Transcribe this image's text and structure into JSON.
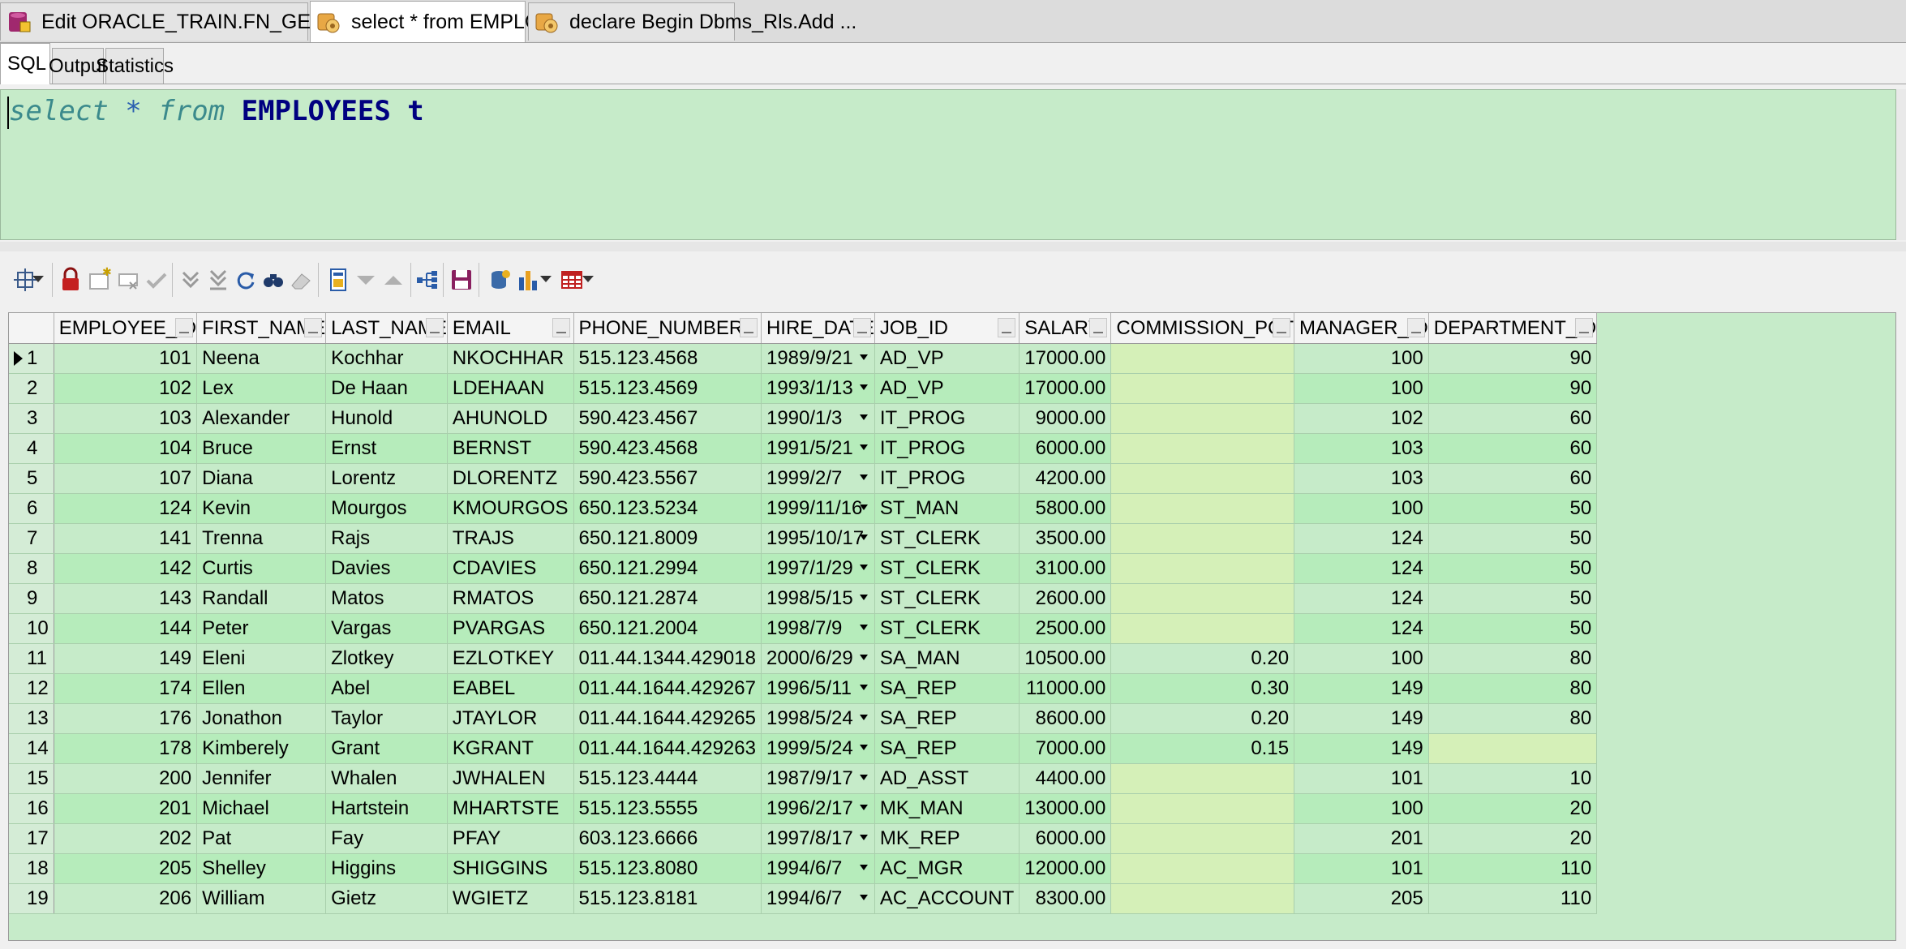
{
  "doc_tabs": [
    {
      "label": "Edit ORACLE_TRAIN.FN_GETEMPLOYEES@ORCL"
    },
    {
      "label": "select * from EMPLOYEES t"
    },
    {
      "label": "declare Begin Dbms_Rls.Add ..."
    }
  ],
  "close_glyph": "✕",
  "sub_tabs": [
    {
      "label": "SQL"
    },
    {
      "label": "Output"
    },
    {
      "label": "Statistics"
    }
  ],
  "editor": {
    "kw_select": "select",
    "op_star": " * ",
    "kw_from": "from",
    "ident": " EMPLOYEES t"
  },
  "toolbar": {
    "icons": [
      "grid-options-icon",
      "lock-icon",
      "insert-record-icon",
      "delete-record-icon",
      "post-changes-icon",
      "next-page-icon",
      "last-page-icon",
      "refresh-icon",
      "find-icon",
      "clear-icon",
      "export-icon",
      "move-down-icon",
      "move-up-icon",
      "query-plan-icon",
      "save-icon",
      "connect-icon",
      "chart-icon",
      "single-record-icon"
    ]
  },
  "grid": {
    "columns": [
      "EMPLOYEE_ID",
      "FIRST_NAME",
      "LAST_NAME",
      "EMAIL",
      "PHONE_NUMBER",
      "HIRE_DATE",
      "JOB_ID",
      "SALARY",
      "COMMISSION_PCT",
      "MANAGER_ID",
      "DEPARTMENT_ID"
    ],
    "dots_glyph": "···",
    "rows": [
      {
        "rn": "1",
        "id": "101",
        "first": "Neena",
        "last": "Kochhar",
        "email": "NKOCHHAR",
        "phone": "515.123.4568",
        "hire": "1989/9/21",
        "job": "AD_VP",
        "salary": "17000.00",
        "comm": "",
        "mgr": "100",
        "dept": "90"
      },
      {
        "rn": "2",
        "id": "102",
        "first": "Lex",
        "last": "De Haan",
        "email": "LDEHAAN",
        "phone": "515.123.4569",
        "hire": "1993/1/13",
        "job": "AD_VP",
        "salary": "17000.00",
        "comm": "",
        "mgr": "100",
        "dept": "90"
      },
      {
        "rn": "3",
        "id": "103",
        "first": "Alexander",
        "last": "Hunold",
        "email": "AHUNOLD",
        "phone": "590.423.4567",
        "hire": "1990/1/3",
        "job": "IT_PROG",
        "salary": "9000.00",
        "comm": "",
        "mgr": "102",
        "dept": "60"
      },
      {
        "rn": "4",
        "id": "104",
        "first": "Bruce",
        "last": "Ernst",
        "email": "BERNST",
        "phone": "590.423.4568",
        "hire": "1991/5/21",
        "job": "IT_PROG",
        "salary": "6000.00",
        "comm": "",
        "mgr": "103",
        "dept": "60"
      },
      {
        "rn": "5",
        "id": "107",
        "first": "Diana",
        "last": "Lorentz",
        "email": "DLORENTZ",
        "phone": "590.423.5567",
        "hire": "1999/2/7",
        "job": "IT_PROG",
        "salary": "4200.00",
        "comm": "",
        "mgr": "103",
        "dept": "60"
      },
      {
        "rn": "6",
        "id": "124",
        "first": "Kevin",
        "last": "Mourgos",
        "email": "KMOURGOS",
        "phone": "650.123.5234",
        "hire": "1999/11/16",
        "job": "ST_MAN",
        "salary": "5800.00",
        "comm": "",
        "mgr": "100",
        "dept": "50"
      },
      {
        "rn": "7",
        "id": "141",
        "first": "Trenna",
        "last": "Rajs",
        "email": "TRAJS",
        "phone": "650.121.8009",
        "hire": "1995/10/17",
        "job": "ST_CLERK",
        "salary": "3500.00",
        "comm": "",
        "mgr": "124",
        "dept": "50"
      },
      {
        "rn": "8",
        "id": "142",
        "first": "Curtis",
        "last": "Davies",
        "email": "CDAVIES",
        "phone": "650.121.2994",
        "hire": "1997/1/29",
        "job": "ST_CLERK",
        "salary": "3100.00",
        "comm": "",
        "mgr": "124",
        "dept": "50"
      },
      {
        "rn": "9",
        "id": "143",
        "first": "Randall",
        "last": "Matos",
        "email": "RMATOS",
        "phone": "650.121.2874",
        "hire": "1998/5/15",
        "job": "ST_CLERK",
        "salary": "2600.00",
        "comm": "",
        "mgr": "124",
        "dept": "50"
      },
      {
        "rn": "10",
        "id": "144",
        "first": "Peter",
        "last": "Vargas",
        "email": "PVARGAS",
        "phone": "650.121.2004",
        "hire": "1998/7/9",
        "job": "ST_CLERK",
        "salary": "2500.00",
        "comm": "",
        "mgr": "124",
        "dept": "50"
      },
      {
        "rn": "11",
        "id": "149",
        "first": "Eleni",
        "last": "Zlotkey",
        "email": "EZLOTKEY",
        "phone": "011.44.1344.429018",
        "hire": "2000/6/29",
        "job": "SA_MAN",
        "salary": "10500.00",
        "comm": "0.20",
        "mgr": "100",
        "dept": "80"
      },
      {
        "rn": "12",
        "id": "174",
        "first": "Ellen",
        "last": "Abel",
        "email": "EABEL",
        "phone": "011.44.1644.429267",
        "hire": "1996/5/11",
        "job": "SA_REP",
        "salary": "11000.00",
        "comm": "0.30",
        "mgr": "149",
        "dept": "80"
      },
      {
        "rn": "13",
        "id": "176",
        "first": "Jonathon",
        "last": "Taylor",
        "email": "JTAYLOR",
        "phone": "011.44.1644.429265",
        "hire": "1998/5/24",
        "job": "SA_REP",
        "salary": "8600.00",
        "comm": "0.20",
        "mgr": "149",
        "dept": "80"
      },
      {
        "rn": "14",
        "id": "178",
        "first": "Kimberely",
        "last": "Grant",
        "email": "KGRANT",
        "phone": "011.44.1644.429263",
        "hire": "1999/5/24",
        "job": "SA_REP",
        "salary": "7000.00",
        "comm": "0.15",
        "mgr": "149",
        "dept": ""
      },
      {
        "rn": "15",
        "id": "200",
        "first": "Jennifer",
        "last": "Whalen",
        "email": "JWHALEN",
        "phone": "515.123.4444",
        "hire": "1987/9/17",
        "job": "AD_ASST",
        "salary": "4400.00",
        "comm": "",
        "mgr": "101",
        "dept": "10"
      },
      {
        "rn": "16",
        "id": "201",
        "first": "Michael",
        "last": "Hartstein",
        "email": "MHARTSTE",
        "phone": "515.123.5555",
        "hire": "1996/2/17",
        "job": "MK_MAN",
        "salary": "13000.00",
        "comm": "",
        "mgr": "100",
        "dept": "20"
      },
      {
        "rn": "17",
        "id": "202",
        "first": "Pat",
        "last": "Fay",
        "email": "PFAY",
        "phone": "603.123.6666",
        "hire": "1997/8/17",
        "job": "MK_REP",
        "salary": "6000.00",
        "comm": "",
        "mgr": "201",
        "dept": "20"
      },
      {
        "rn": "18",
        "id": "205",
        "first": "Shelley",
        "last": "Higgins",
        "email": "SHIGGINS",
        "phone": "515.123.8080",
        "hire": "1994/6/7",
        "job": "AC_MGR",
        "salary": "12000.00",
        "comm": "",
        "mgr": "101",
        "dept": "110"
      },
      {
        "rn": "19",
        "id": "206",
        "first": "William",
        "last": "Gietz",
        "email": "WGIETZ",
        "phone": "515.123.8181",
        "hire": "1994/6/7",
        "job": "AC_ACCOUNT",
        "salary": "8300.00",
        "comm": "",
        "mgr": "205",
        "dept": "110"
      }
    ]
  }
}
